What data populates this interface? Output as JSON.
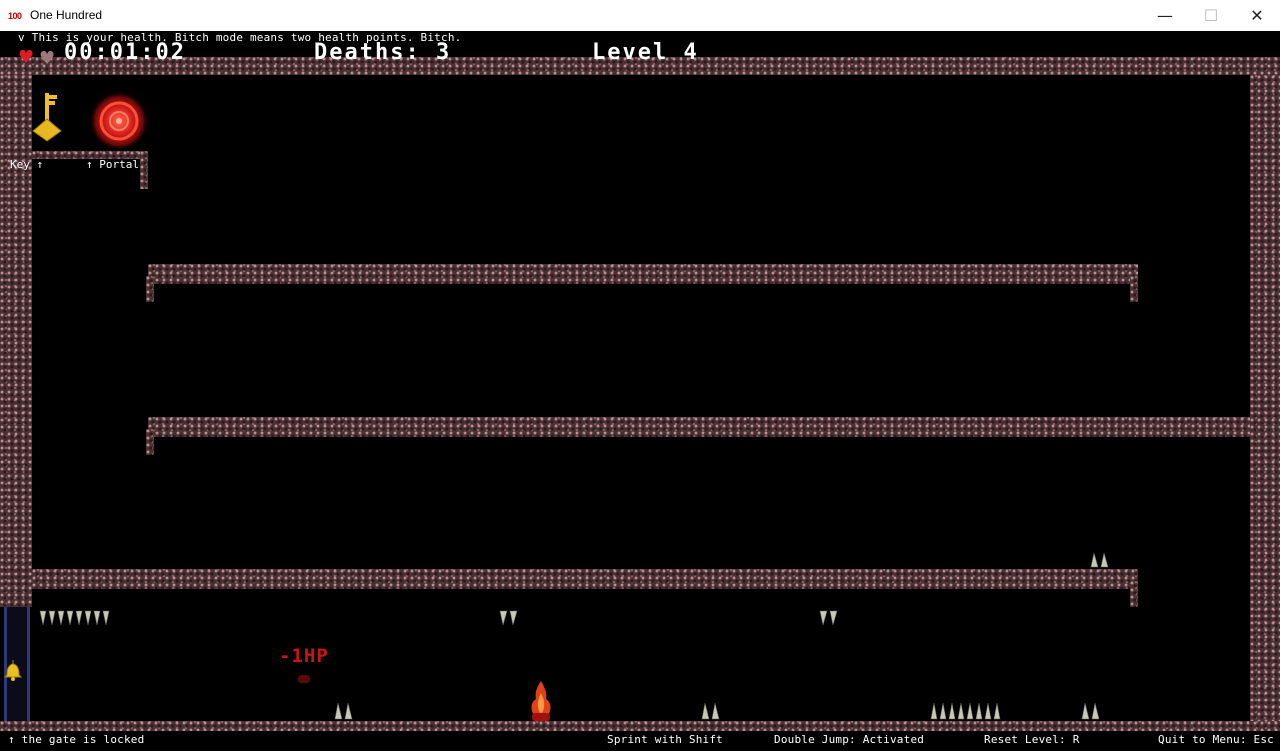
{
  "window": {
    "icon_text": "100",
    "title": "One Hundred",
    "minimize_glyph": "—",
    "maximize_glyph": "☐",
    "close_glyph": "✕"
  },
  "hud": {
    "health_hint": "v This is your health. Bitch mode means two health points. Bitch.",
    "timer": "00:01:02",
    "deaths": "Deaths: 3",
    "level": "Level 4",
    "health": {
      "current": 1,
      "max": 2
    }
  },
  "labels": {
    "key": "Key ↑",
    "portal": "↑ Portal",
    "damage": "-1HP"
  },
  "footer": {
    "gate": "↑ the gate is locked",
    "sprint": "Sprint with Shift",
    "double_jump": "Double Jump: Activated",
    "reset": "Reset Level: R",
    "quit": "Quit to Menu: Esc"
  },
  "colors": {
    "rock": "#4a2f33",
    "portal": "#d81e1e",
    "key": "#e8b820",
    "damage_text": "#c81414",
    "heart_full": "#e01b24",
    "heart_empty": "#9a7a7a"
  },
  "icons": {
    "key": "key-icon",
    "portal": "portal-icon",
    "player": "player-flame-icon",
    "spike": "spike-icon",
    "bell": "bell-icon",
    "heart": "heart-icon"
  }
}
